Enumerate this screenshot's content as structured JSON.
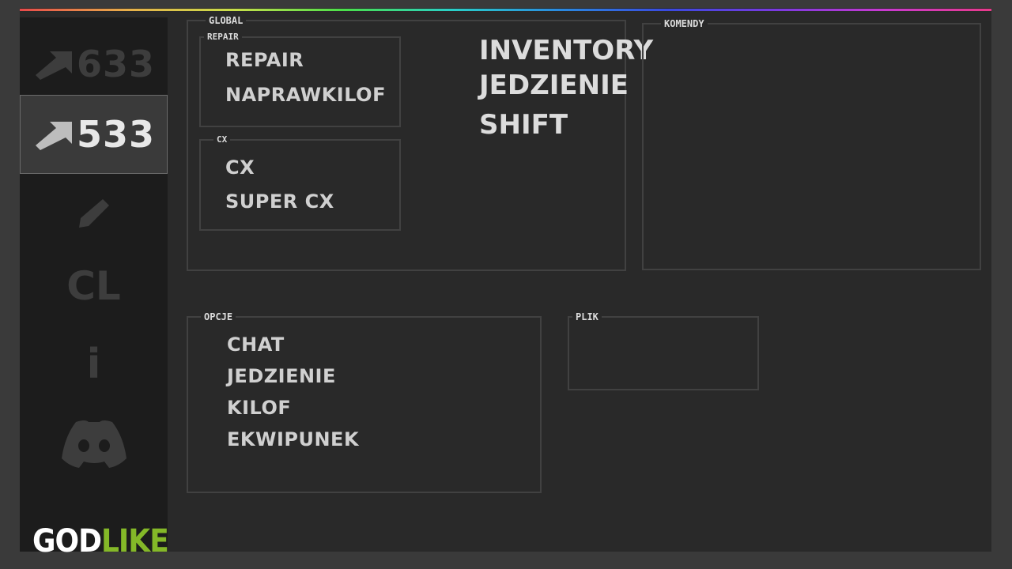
{
  "sidebar": {
    "items": [
      {
        "label": "633",
        "icon": "pickaxe-icon"
      },
      {
        "label": "533",
        "icon": "pickaxe-icon"
      },
      {
        "icon": "pencil-icon"
      },
      {
        "label": "CL"
      },
      {
        "label": "i"
      },
      {
        "icon": "discord-icon"
      }
    ],
    "logo_part1": "GOD",
    "logo_part2": "LIKE",
    "logo_accent": "#84b828"
  },
  "global": {
    "legend": "GLOBAL",
    "repair": {
      "legend": "REPAIR",
      "items": [
        "REPAIR",
        "NAPRAWKILOF"
      ]
    },
    "cx": {
      "legend": "CX",
      "items": [
        "CX",
        "SUPER CX"
      ]
    },
    "actions": [
      "INVENTORY",
      "JEDZIENIE",
      "SHIFT"
    ]
  },
  "komendy": {
    "legend": "KOMENDY"
  },
  "opcje": {
    "legend": "OPCJE",
    "items": [
      "CHAT",
      "JEDZIENIE",
      "KILOF",
      "EKWIPUNEK"
    ]
  },
  "plik": {
    "legend": "PLIK"
  }
}
